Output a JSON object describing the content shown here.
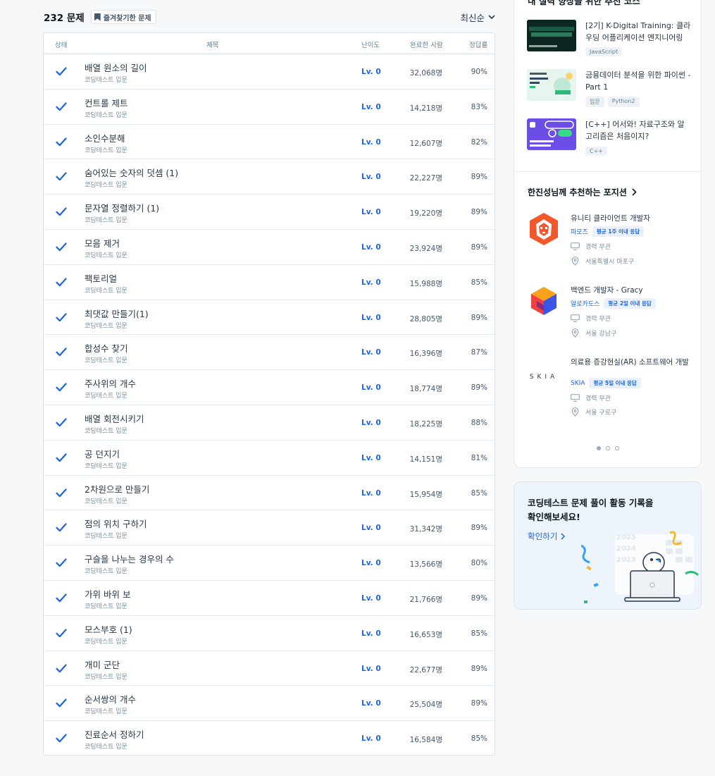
{
  "header": {
    "count": "232 문제",
    "favorite_label": "즐겨찾기한 문제",
    "sort_label": "최신순"
  },
  "table": {
    "columns": {
      "status": "상태",
      "title": "제목",
      "level": "난이도",
      "completed": "완료한 사람",
      "rate": "정답률"
    },
    "rows": [
      {
        "title": "배열 원소의 길이",
        "category": "코딩테스트 입문",
        "level": "Lv. 0",
        "completed": "32,068명",
        "rate": "90%"
      },
      {
        "title": "컨트롤 제트",
        "category": "코딩테스트 입문",
        "level": "Lv. 0",
        "completed": "14,218명",
        "rate": "83%"
      },
      {
        "title": "소인수분해",
        "category": "코딩테스트 입문",
        "level": "Lv. 0",
        "completed": "12,607명",
        "rate": "82%"
      },
      {
        "title": "숨어있는 숫자의 덧셈 (1)",
        "category": "코딩테스트 입문",
        "level": "Lv. 0",
        "completed": "22,227명",
        "rate": "89%"
      },
      {
        "title": "문자열 정렬하기 (1)",
        "category": "코딩테스트 입문",
        "level": "Lv. 0",
        "completed": "19,220명",
        "rate": "89%"
      },
      {
        "title": "모음 제거",
        "category": "코딩테스트 입문",
        "level": "Lv. 0",
        "completed": "23,924명",
        "rate": "89%"
      },
      {
        "title": "팩토리얼",
        "category": "코딩테스트 입문",
        "level": "Lv. 0",
        "completed": "15,988명",
        "rate": "85%"
      },
      {
        "title": "최댓값 만들기(1)",
        "category": "코딩테스트 입문",
        "level": "Lv. 0",
        "completed": "28,805명",
        "rate": "89%"
      },
      {
        "title": "합성수 찾기",
        "category": "코딩테스트 입문",
        "level": "Lv. 0",
        "completed": "16,396명",
        "rate": "87%"
      },
      {
        "title": "주사위의 개수",
        "category": "코딩테스트 입문",
        "level": "Lv. 0",
        "completed": "18,774명",
        "rate": "89%"
      },
      {
        "title": "배열 회전시키기",
        "category": "코딩테스트 입문",
        "level": "Lv. 0",
        "completed": "18,225명",
        "rate": "88%"
      },
      {
        "title": "공 던지기",
        "category": "코딩테스트 입문",
        "level": "Lv. 0",
        "completed": "14,151명",
        "rate": "81%"
      },
      {
        "title": "2차원으로 만들기",
        "category": "코딩테스트 입문",
        "level": "Lv. 0",
        "completed": "15,954명",
        "rate": "85%"
      },
      {
        "title": "점의 위치 구하기",
        "category": "코딩테스트 입문",
        "level": "Lv. 0",
        "completed": "31,342명",
        "rate": "89%"
      },
      {
        "title": "구슬을 나누는 경우의 수",
        "category": "코딩테스트 입문",
        "level": "Lv. 0",
        "completed": "13,566명",
        "rate": "80%"
      },
      {
        "title": "가위 바위 보",
        "category": "코딩테스트 입문",
        "level": "Lv. 0",
        "completed": "21,766명",
        "rate": "89%"
      },
      {
        "title": "모스부호 (1)",
        "category": "코딩테스트 입문",
        "level": "Lv. 0",
        "completed": "16,653명",
        "rate": "85%"
      },
      {
        "title": "개미 군단",
        "category": "코딩테스트 입문",
        "level": "Lv. 0",
        "completed": "22,677명",
        "rate": "89%"
      },
      {
        "title": "순서쌍의 개수",
        "category": "코딩테스트 입문",
        "level": "Lv. 0",
        "completed": "25,504명",
        "rate": "89%"
      },
      {
        "title": "진료순서 정하기",
        "category": "코딩테스트 입문",
        "level": "Lv. 0",
        "completed": "16,584명",
        "rate": "85%"
      }
    ]
  },
  "courses": {
    "section_title": "내 실력 향상을 위한 추천 코스",
    "items": [
      {
        "title": "[2기] K-Digital Training: 클라우딩 어플리케이션 엔지니어링",
        "tags": [
          "JavaScript"
        ]
      },
      {
        "title": "금융데이터 분석을 위한 파이썬 - Part 1",
        "tags": [
          "입문",
          "Python2"
        ]
      },
      {
        "title": "[C++] 어서와! 자료구조와 알고리즘은 처음이지?",
        "tags": [
          "C++"
        ]
      }
    ]
  },
  "positions": {
    "title": "한진성님께 추천하는 포지션",
    "items": [
      {
        "title": "유니티 클라이언트 개발자",
        "company": "파모즈",
        "response": "평균 1주 이내 응답",
        "career": "경력 무관",
        "location": "서울특별시 마포구"
      },
      {
        "title": "백엔드 개발자 - Gracy",
        "company": "알로카도스",
        "response": "평균 2일 이내 응답",
        "career": "경력 무관",
        "location": "서울 강남구"
      },
      {
        "title": "의료용 증강현실(AR) 소프트웨어 개발",
        "company": "SKIA",
        "response": "평균 5일 이내 응답",
        "career": "경력 무관",
        "location": "서울 구로구"
      }
    ],
    "skia_logo_text": "SKIA"
  },
  "activity": {
    "line1": "코딩테스트 문제 풀이 활동 기록을",
    "line2": "확인해보세요!",
    "link": "확인하기",
    "years": [
      "2025",
      "2024",
      "2023"
    ]
  },
  "colors": {
    "accent": "#1b64da",
    "check": "#1b64da",
    "text": "#263747"
  }
}
